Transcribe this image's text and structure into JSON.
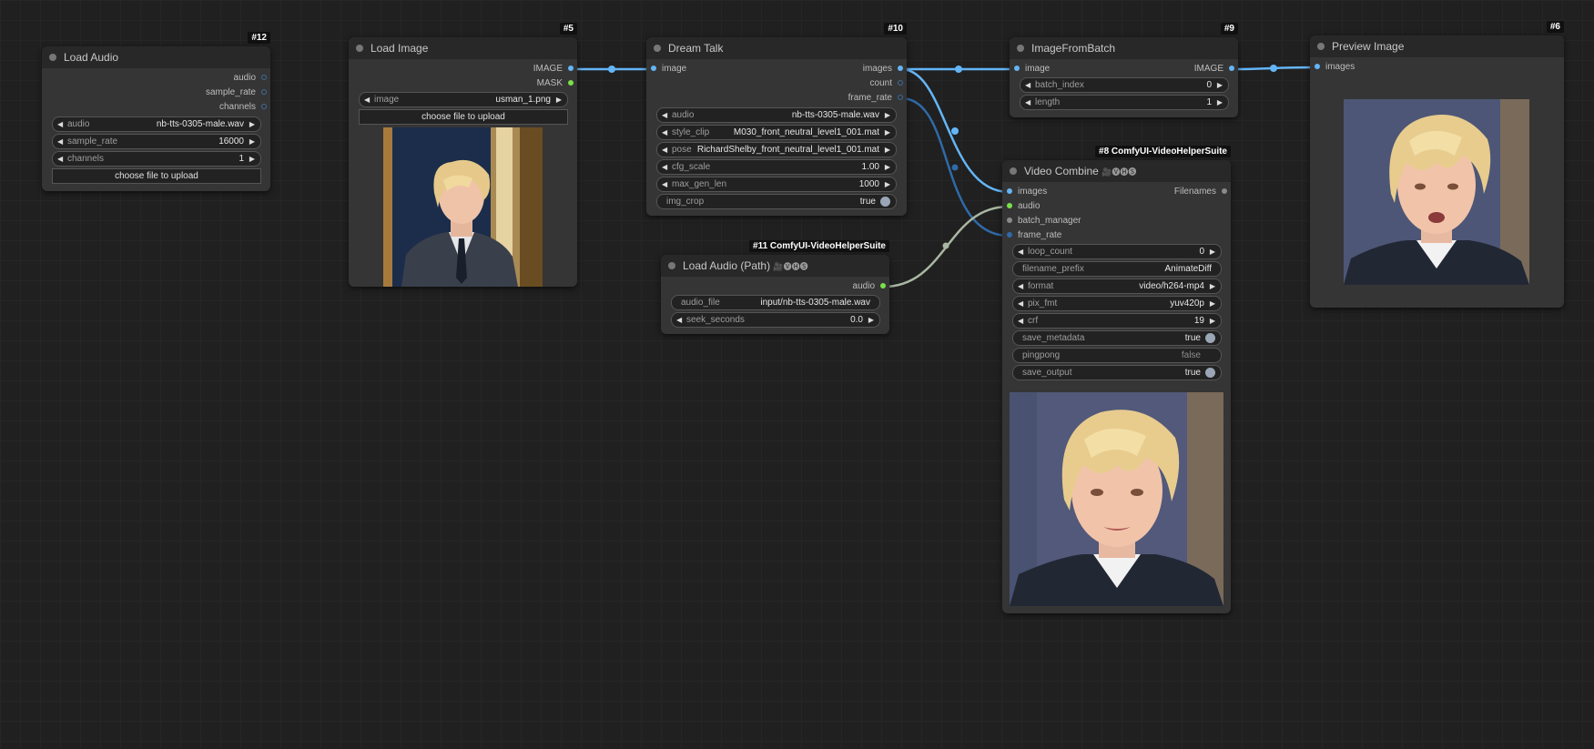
{
  "nodes": {
    "load_audio": {
      "id": "#12",
      "title": "Load Audio",
      "outputs": [
        "audio",
        "sample_rate",
        "channels"
      ],
      "widgets": [
        {
          "label": "audio",
          "value": "nb-tts-0305-male.wav"
        },
        {
          "label": "sample_rate",
          "value": "16000"
        },
        {
          "label": "channels",
          "value": "1"
        }
      ],
      "button": "choose file to upload"
    },
    "load_image": {
      "id": "#5",
      "title": "Load Image",
      "outputs": [
        "IMAGE",
        "MASK"
      ],
      "widgets": [
        {
          "label": "image",
          "value": "usman_1.png"
        }
      ],
      "button": "choose file to upload"
    },
    "dream_talk": {
      "id": "#10",
      "title": "Dream Talk",
      "inputs": [
        "image"
      ],
      "outputs": [
        "images",
        "count",
        "frame_rate"
      ],
      "widgets": [
        {
          "label": "audio",
          "value": "nb-tts-0305-male.wav"
        },
        {
          "label": "style_clip",
          "value": "M030_front_neutral_level1_001.mat"
        },
        {
          "label": "pose",
          "value": "RichardShelby_front_neutral_level1_001.mat"
        },
        {
          "label": "cfg_scale",
          "value": "1.00"
        },
        {
          "label": "max_gen_len",
          "value": "1000"
        },
        {
          "label": "img_crop",
          "value": "true"
        }
      ]
    },
    "load_audio_path": {
      "id": "#11 ComfyUI-VideoHelperSuite",
      "title": "Load Audio (Path)",
      "title_suffix": "🎥🅥🅗🅢",
      "outputs": [
        "audio"
      ],
      "widgets": [
        {
          "label": "audio_file",
          "value": "input/nb-tts-0305-male.wav"
        },
        {
          "label": "seek_seconds",
          "value": "0.0"
        }
      ]
    },
    "image_from_batch": {
      "id": "#9",
      "title": "ImageFromBatch",
      "inputs": [
        "image"
      ],
      "outputs": [
        "IMAGE"
      ],
      "widgets": [
        {
          "label": "batch_index",
          "value": "0"
        },
        {
          "label": "length",
          "value": "1"
        }
      ]
    },
    "video_combine": {
      "id": "#8 ComfyUI-VideoHelperSuite",
      "title": "Video Combine",
      "title_suffix": "🎥🅥🅗🅢",
      "inputs": [
        "images",
        "audio",
        "batch_manager",
        "frame_rate"
      ],
      "outputs": [
        "Filenames"
      ],
      "widgets": [
        {
          "label": "loop_count",
          "value": "0"
        },
        {
          "label": "filename_prefix",
          "value": "AnimateDiff"
        },
        {
          "label": "format",
          "value": "video/h264-mp4"
        },
        {
          "label": "pix_fmt",
          "value": "yuv420p"
        },
        {
          "label": "crf",
          "value": "19"
        },
        {
          "label": "save_metadata",
          "value": "true"
        },
        {
          "label": "pingpong",
          "value": "false"
        },
        {
          "label": "save_output",
          "value": "true"
        }
      ]
    },
    "preview_image": {
      "id": "#6",
      "title": "Preview Image",
      "inputs": [
        "images"
      ]
    }
  },
  "colors": {
    "image_link": "#64b5f6",
    "int_link": "#2f6aa8",
    "audio_link": "#a9b7a2",
    "mask_dot": "#7ae04b"
  },
  "icons": {
    "arrow_left": "◀",
    "arrow_right": "▶"
  }
}
